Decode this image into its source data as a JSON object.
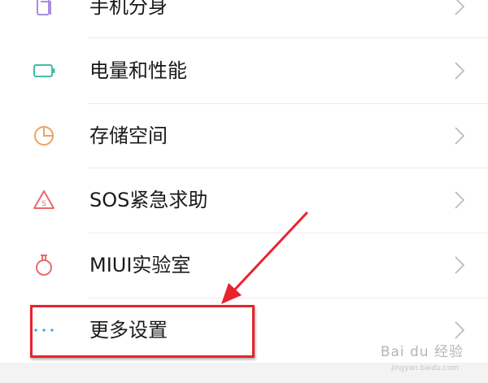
{
  "settings_list": {
    "items": [
      {
        "label": "手机分身",
        "icon": "phone-clone-icon",
        "icon_color": "#a98de0"
      },
      {
        "label": "电量和性能",
        "icon": "battery-icon",
        "icon_color": "#3fbfa6"
      },
      {
        "label": "存储空间",
        "icon": "storage-pie-icon",
        "icon_color": "#f0a060"
      },
      {
        "label": "SOS紧急求助",
        "icon": "sos-triangle-icon",
        "icon_color": "#ea6b6b",
        "icon_glyph": "S"
      },
      {
        "label": "MIUI实验室",
        "icon": "lab-flask-icon",
        "icon_color": "#ea6b6b"
      },
      {
        "label": "更多设置",
        "icon": "more-dots-icon",
        "icon_color": "#3aa0e6"
      }
    ]
  },
  "annotation": {
    "highlight_color": "#e8232e",
    "highlighted_item": "更多设置"
  },
  "watermark": {
    "text": "Bai du 经验",
    "sub": "jingyan.baidu.com"
  }
}
